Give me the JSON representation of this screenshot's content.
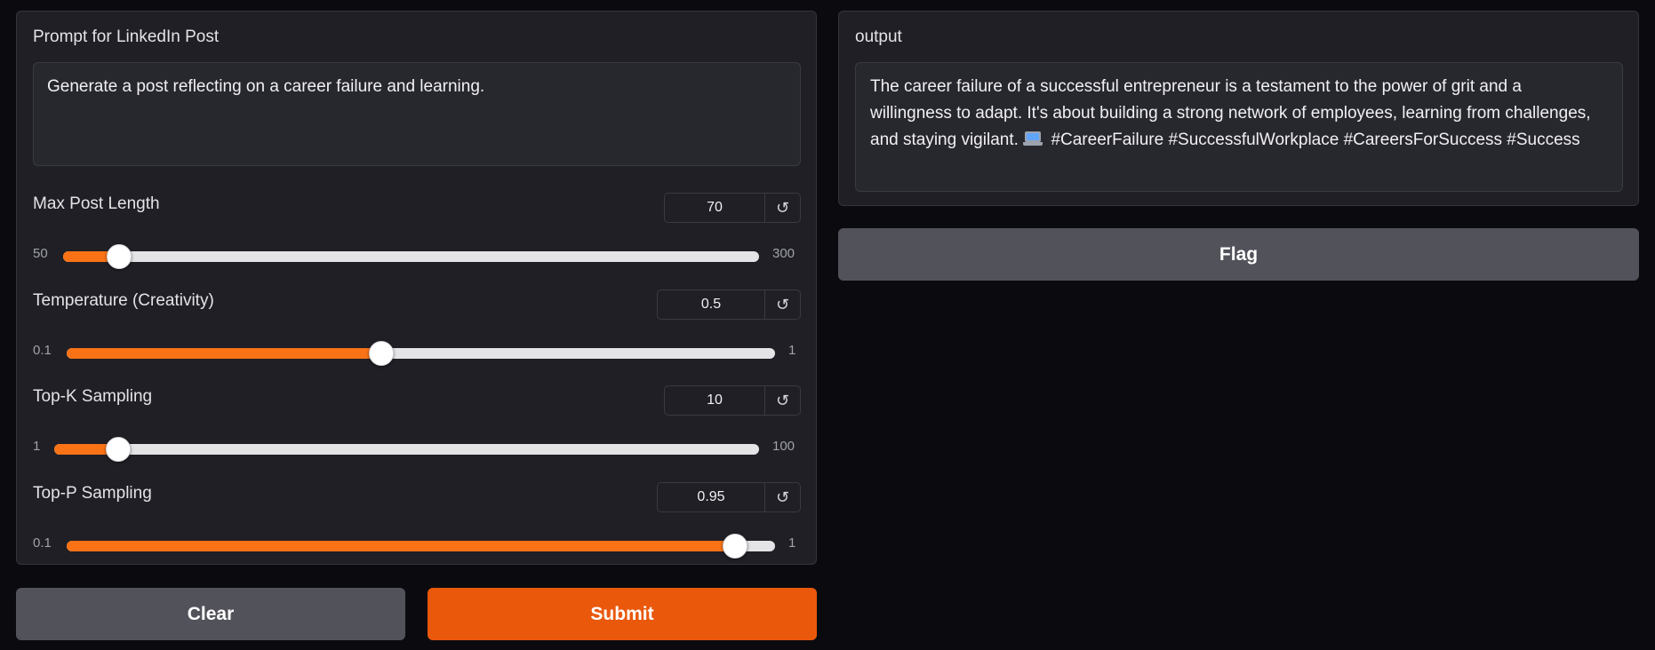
{
  "input": {
    "prompt_label": "Prompt for LinkedIn Post",
    "prompt_value": "Generate a post reflecting on a career failure and learning."
  },
  "sliders": [
    {
      "label": "Max Post Length",
      "value": "70",
      "min": "50",
      "max": "300",
      "fraction": 0.08
    },
    {
      "label": "Temperature (Creativity)",
      "value": "0.5",
      "min": "0.1",
      "max": "1",
      "fraction": 0.444
    },
    {
      "label": "Top-K Sampling",
      "value": "10",
      "min": "1",
      "max": "100",
      "fraction": 0.091
    },
    {
      "label": "Top-P Sampling",
      "value": "0.95",
      "min": "0.1",
      "max": "1",
      "fraction": 0.944
    }
  ],
  "reset_icon": "↺",
  "buttons": {
    "clear": "Clear",
    "submit": "Submit",
    "flag": "Flag"
  },
  "output": {
    "label": "output",
    "text_before_icon": "The career failure of a successful entrepreneur is a testament to the power of grit and a willingness to adapt. It's about building a strong network of employees, learning from challenges, and staying vigilant.",
    "emoji": "laptop-icon",
    "text_after_icon": "#CareerFailure #SuccessfulWorkplace #CareersForSuccess #Success"
  },
  "colors": {
    "accent": "#f97316",
    "submit": "#ea580c",
    "panel": "#1f1f25",
    "background": "#0b0b0f"
  }
}
